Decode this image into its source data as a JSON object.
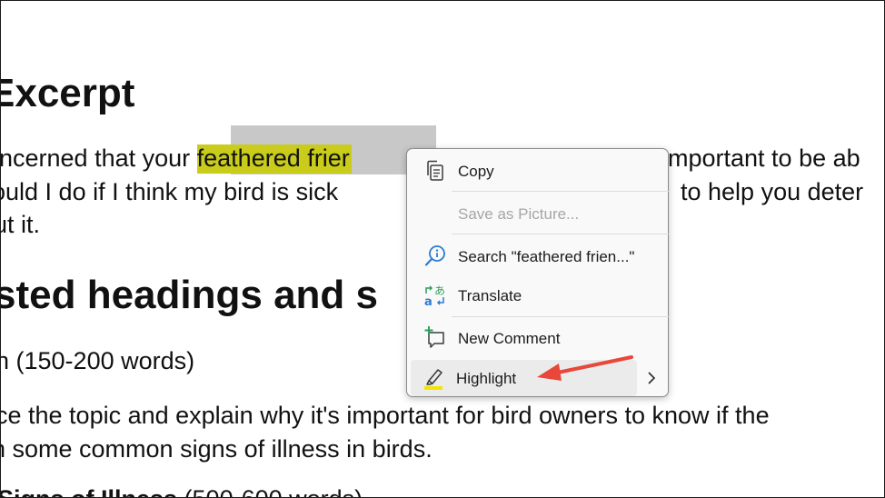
{
  "document": {
    "heading_excerpt": "Excerpt",
    "line1_before": "ncerned that your ",
    "line1_highlight": "feathered frier",
    "line1_after": "mportant to be ab",
    "line2_before": "ould I do if I think my bird is sick",
    "line2_after": "to help you deter",
    "line3": "ut it.",
    "heading_suggested": "sted headings and s",
    "line4": "n (150-200 words)",
    "line5": "ce the topic and explain why it's important for bird owners to know if the",
    "line6": "n some common signs of illness in birds.",
    "line7_bold": "Signs of Illness",
    "line7_rest": " (500-600 words)"
  },
  "context_menu": {
    "copy": "Copy",
    "save_as_picture": "Save as Picture...",
    "search": "Search \"feathered frien...\"",
    "translate": "Translate",
    "new_comment": "New Comment",
    "highlight": "Highlight"
  },
  "colors": {
    "highlight_yellow": "#c9cc1a",
    "annotation_arrow": "#e8473a",
    "selection_gray": "#c8c8c8"
  }
}
